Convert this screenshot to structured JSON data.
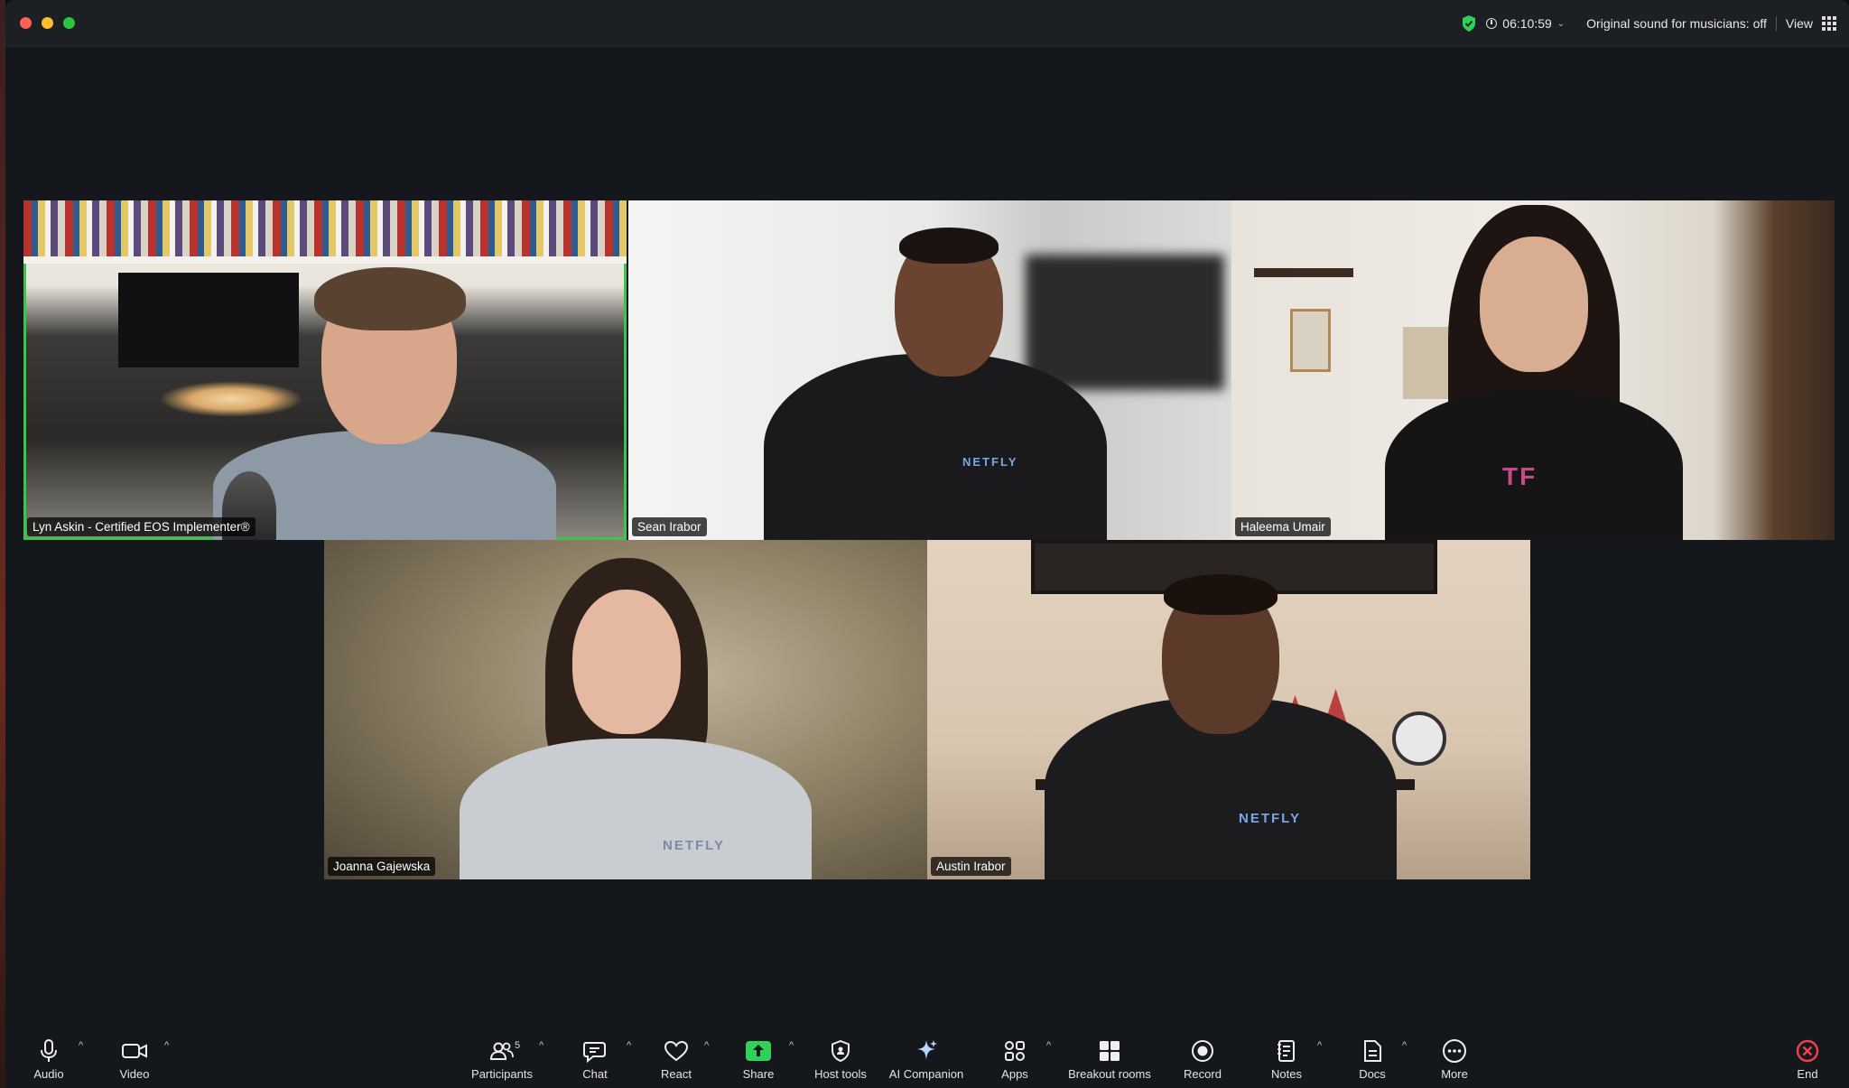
{
  "titlebar": {
    "timer": "06:10:59",
    "original_sound": "Original sound for musicians: off",
    "view_label": "View"
  },
  "participants": [
    {
      "name": "Lyn Askin - Certified EOS Implementer®",
      "active_speaker": true
    },
    {
      "name": "Sean Irabor",
      "active_speaker": false
    },
    {
      "name": "Haleema Umair",
      "active_speaker": false
    },
    {
      "name": "Joanna Gajewska",
      "active_speaker": false
    },
    {
      "name": "Austin Irabor",
      "active_speaker": false
    }
  ],
  "shirt_logo": "NETFLY",
  "toolbar": {
    "audio": "Audio",
    "video": "Video",
    "participants": "Participants",
    "participant_count": "5",
    "chat": "Chat",
    "react": "React",
    "share": "Share",
    "host_tools": "Host tools",
    "ai_companion": "AI Companion",
    "apps": "Apps",
    "breakout_rooms": "Breakout rooms",
    "record": "Record",
    "notes": "Notes",
    "docs": "Docs",
    "more": "More",
    "end": "End"
  },
  "colors": {
    "active_speaker_border": "#3ec44a",
    "share_green": "#2fd15a",
    "end_red": "#ef3f4a",
    "background": "#14171c"
  }
}
